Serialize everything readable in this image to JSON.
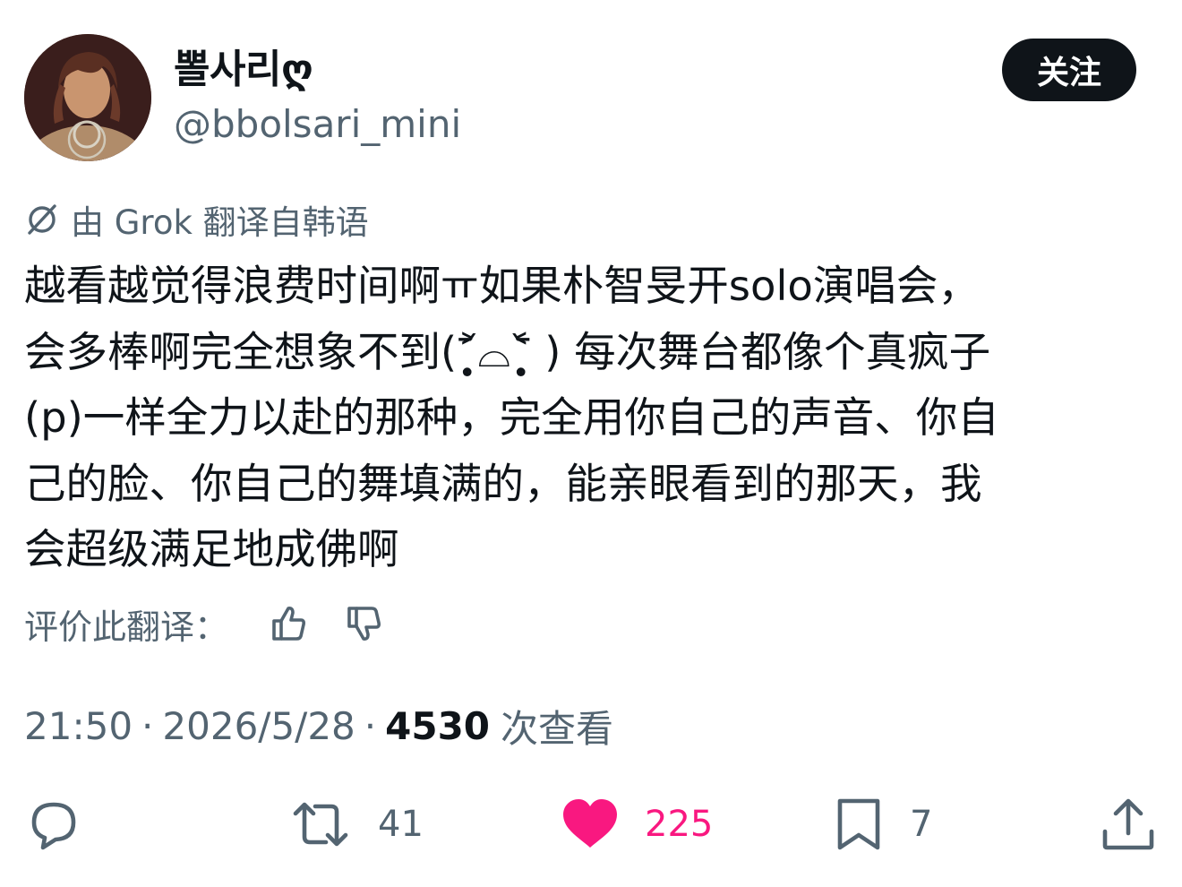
{
  "author": {
    "display_name": "뽈사리ღ",
    "handle": "@bbolsari_mini"
  },
  "follow_button": {
    "label": "关注"
  },
  "translation_note": {
    "text": "由 Grok 翻译自韩语"
  },
  "tweet": {
    "text": "越看越觉得浪费时间啊ㅠ如果朴智旻开solo演唱会，\n会多棒啊完全想象不到(˃̣̣̥᷄⌓˂̣̣̥᷅ ) 每次舞台都像个真疯子\n(p)一样全力以赴的那种，完全用你自己的声音、你自\n己的脸、你自己的舞填满的，能亲眼看到的那天，我\n会超级满足地成佛啊"
  },
  "rate_translation": {
    "label": "评价此翻译："
  },
  "meta": {
    "time": "21:50",
    "date": "2026/5/28",
    "views_count": "4530",
    "views_label": "次查看",
    "separator": "·"
  },
  "actions": {
    "reply": {
      "icon": "reply-icon"
    },
    "retweet": {
      "icon": "retweet-icon",
      "count": "41"
    },
    "like": {
      "icon": "heart-icon",
      "count": "225",
      "liked": true,
      "color": "#f91880"
    },
    "bookmark": {
      "icon": "bookmark-icon",
      "count": "7"
    },
    "share": {
      "icon": "share-icon"
    }
  },
  "colors": {
    "text_primary": "#0f1419",
    "text_secondary": "#536471",
    "like_pink": "#f91880",
    "button_dark": "#0f1419"
  }
}
